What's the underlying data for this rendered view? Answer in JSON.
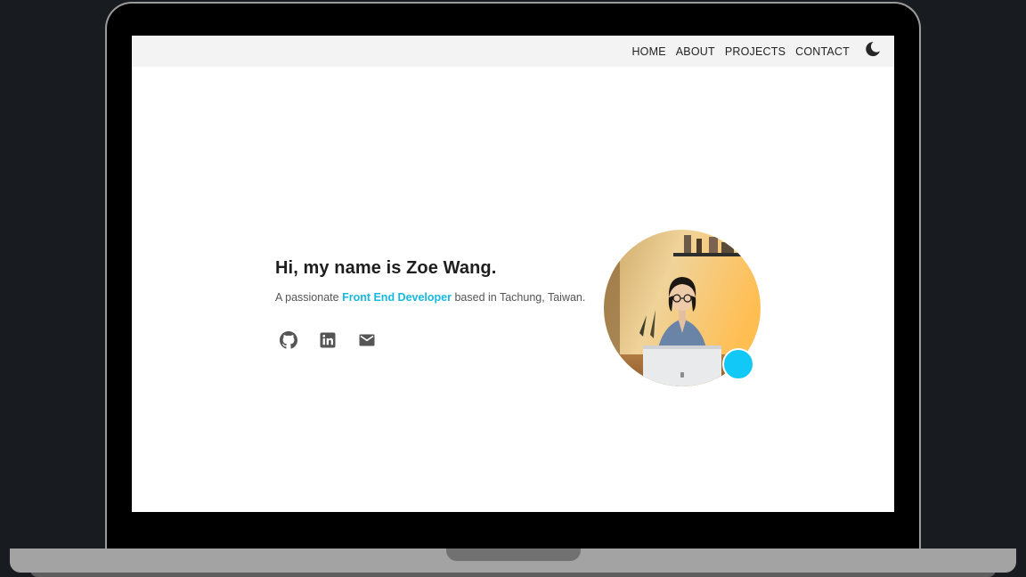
{
  "nav": {
    "links": [
      "HOME",
      "ABOUT",
      "PROJECTS",
      "CONTACT"
    ],
    "theme_toggle_icon": "moon-icon"
  },
  "hero": {
    "title": "Hi, my name is Zoe Wang.",
    "subtitle_prefix": "A passionate ",
    "subtitle_highlight": "Front End Developer",
    "subtitle_suffix": " based in Tachung, Taiwan.",
    "accent_color": "#18b8e0"
  },
  "socials": [
    {
      "icon": "github-icon"
    },
    {
      "icon": "linkedin-icon"
    },
    {
      "icon": "mail-icon"
    }
  ],
  "status_color": "#12c8f6"
}
